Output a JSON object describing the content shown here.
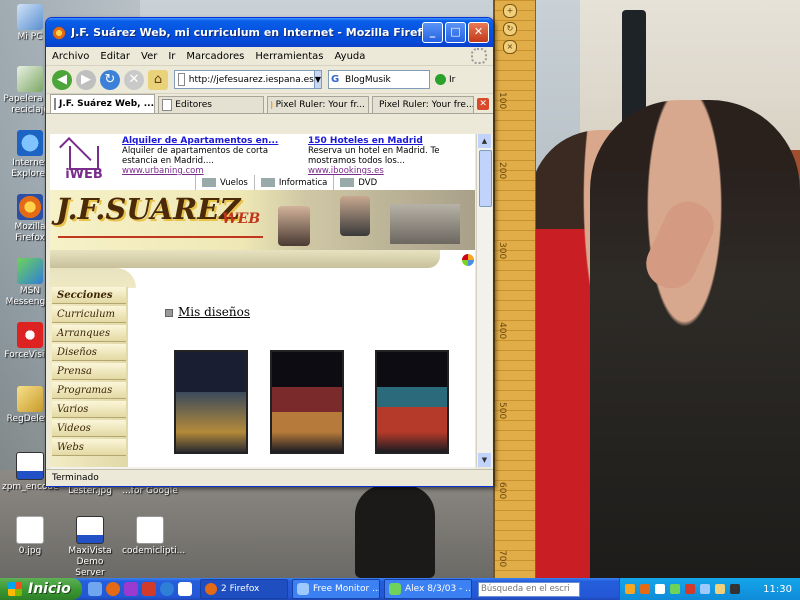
{
  "desktop": {
    "icons": [
      {
        "label": "Mi PC",
        "icon": "computer-icon"
      },
      {
        "label": "Papelera de reciclaje",
        "icon": "recycle-bin-icon"
      },
      {
        "label": "Internet Explorer",
        "icon": "internet-explorer-icon"
      },
      {
        "label": "Mozilla Firefox",
        "icon": "firefox-icon"
      },
      {
        "label": "MSN Messenger",
        "icon": "msn-icon"
      },
      {
        "label": "ForceVision",
        "icon": "forcevision-icon"
      },
      {
        "label": "RegDelete",
        "icon": "regdelete-icon"
      },
      {
        "label": "zpm_encode",
        "icon": "monitor-icon"
      },
      {
        "label": "0.jpg",
        "icon": "image-file-icon"
      },
      {
        "label": "MaxiVista Demo Server",
        "icon": "maxivista-icon"
      },
      {
        "label": "codemiclipti...",
        "icon": "document-icon"
      },
      {
        "label": "...for Google",
        "icon": "document-icon"
      },
      {
        "label": "Lester.jpg",
        "icon": "image-file-icon"
      }
    ]
  },
  "ruler": {
    "marks": [
      "100",
      "200",
      "300",
      "400",
      "500",
      "600",
      "700"
    ]
  },
  "window": {
    "title": "J.F. Suárez Web, mi curriculum en Internet - Mozilla Firefox",
    "menu": [
      "Archivo",
      "Editar",
      "Ver",
      "Ir",
      "Marcadores",
      "Herramientas",
      "Ayuda"
    ],
    "url": "http://jefesuarez.iespana.es",
    "search_engine_label": "BlogMusik",
    "go_label": "Ir",
    "tabs": [
      {
        "label": "J.F. Suárez Web, ...",
        "active": true,
        "icon": "page-icon"
      },
      {
        "label": "Editores",
        "active": false,
        "icon": "page-icon"
      },
      {
        "label": "Pixel Ruler: Your fr...",
        "active": false,
        "icon": "ruler-icon"
      },
      {
        "label": "Pixel Ruler: Your fre...",
        "active": false,
        "icon": "ruler-icon"
      }
    ],
    "status": "Terminado"
  },
  "ad": {
    "logo": "iWEB",
    "items": [
      {
        "title": "Alquiler de Apartamentos en...",
        "text": "Alquiler de apartamentos de corta estancia en Madrid....",
        "url": "www.urbaning.com"
      },
      {
        "title": "150 Hoteles en Madrid",
        "text": "Reserva un hotel en Madrid. Te mostramos todos los...",
        "url": "www.ibookings.es"
      }
    ],
    "nav": [
      "Vuelos",
      "Informatica",
      "DVD"
    ]
  },
  "site": {
    "logo": "J.F.SUAREZ",
    "logo_suffix": "WEB",
    "menu": [
      "Secciones",
      "Curriculum",
      "Arranques",
      "Diseños",
      "Prensa",
      "Programas",
      "Varios",
      "Videos",
      "Webs"
    ],
    "section_title": "Mis diseños",
    "thumbnails": [
      "design-thumbnail-1",
      "design-thumbnail-2",
      "design-thumbnail-3"
    ]
  },
  "taskbar": {
    "start_label": "Inicio",
    "buttons": [
      {
        "label": "2 Firefox",
        "active": true
      },
      {
        "label": "Free Monitor ...",
        "active": false
      },
      {
        "label": "Alex 8/3/03 - ...",
        "active": false
      }
    ],
    "search_placeholder": "Búsqueda en el escri",
    "clock": "11:30"
  }
}
